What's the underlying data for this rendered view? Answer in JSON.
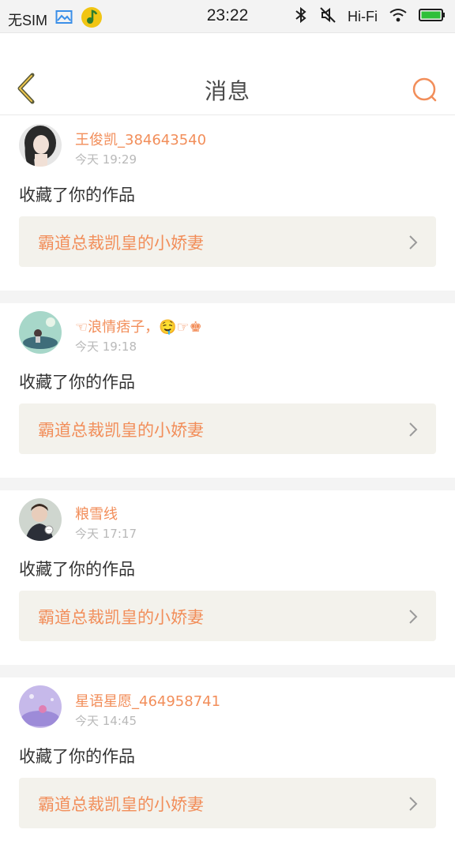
{
  "status_bar": {
    "carrier": "无SIM",
    "time": "23:22",
    "hifi": "Hi-Fi"
  },
  "header": {
    "title": "消息"
  },
  "colors": {
    "accent": "#f28e5a",
    "work_box_bg": "#f3f2ec",
    "separator": "#f4f4f4"
  },
  "messages": [
    {
      "username": "王俊凯_384643540",
      "time": "今天 19:29",
      "action": "收藏了你的作品",
      "work_title": "霸道总裁凯皇的小娇妻"
    },
    {
      "username": "☜浪情痞子，🤤☞♚",
      "time": "今天 19:18",
      "action": "收藏了你的作品",
      "work_title": "霸道总裁凯皇的小娇妻"
    },
    {
      "username": "粮雪线",
      "time": "今天 17:17",
      "action": "收藏了你的作品",
      "work_title": "霸道总裁凯皇的小娇妻"
    },
    {
      "username": "星语星愿_464958741",
      "time": "今天 14:45",
      "action": "收藏了你的作品",
      "work_title": "霸道总裁凯皇的小娇妻"
    }
  ]
}
